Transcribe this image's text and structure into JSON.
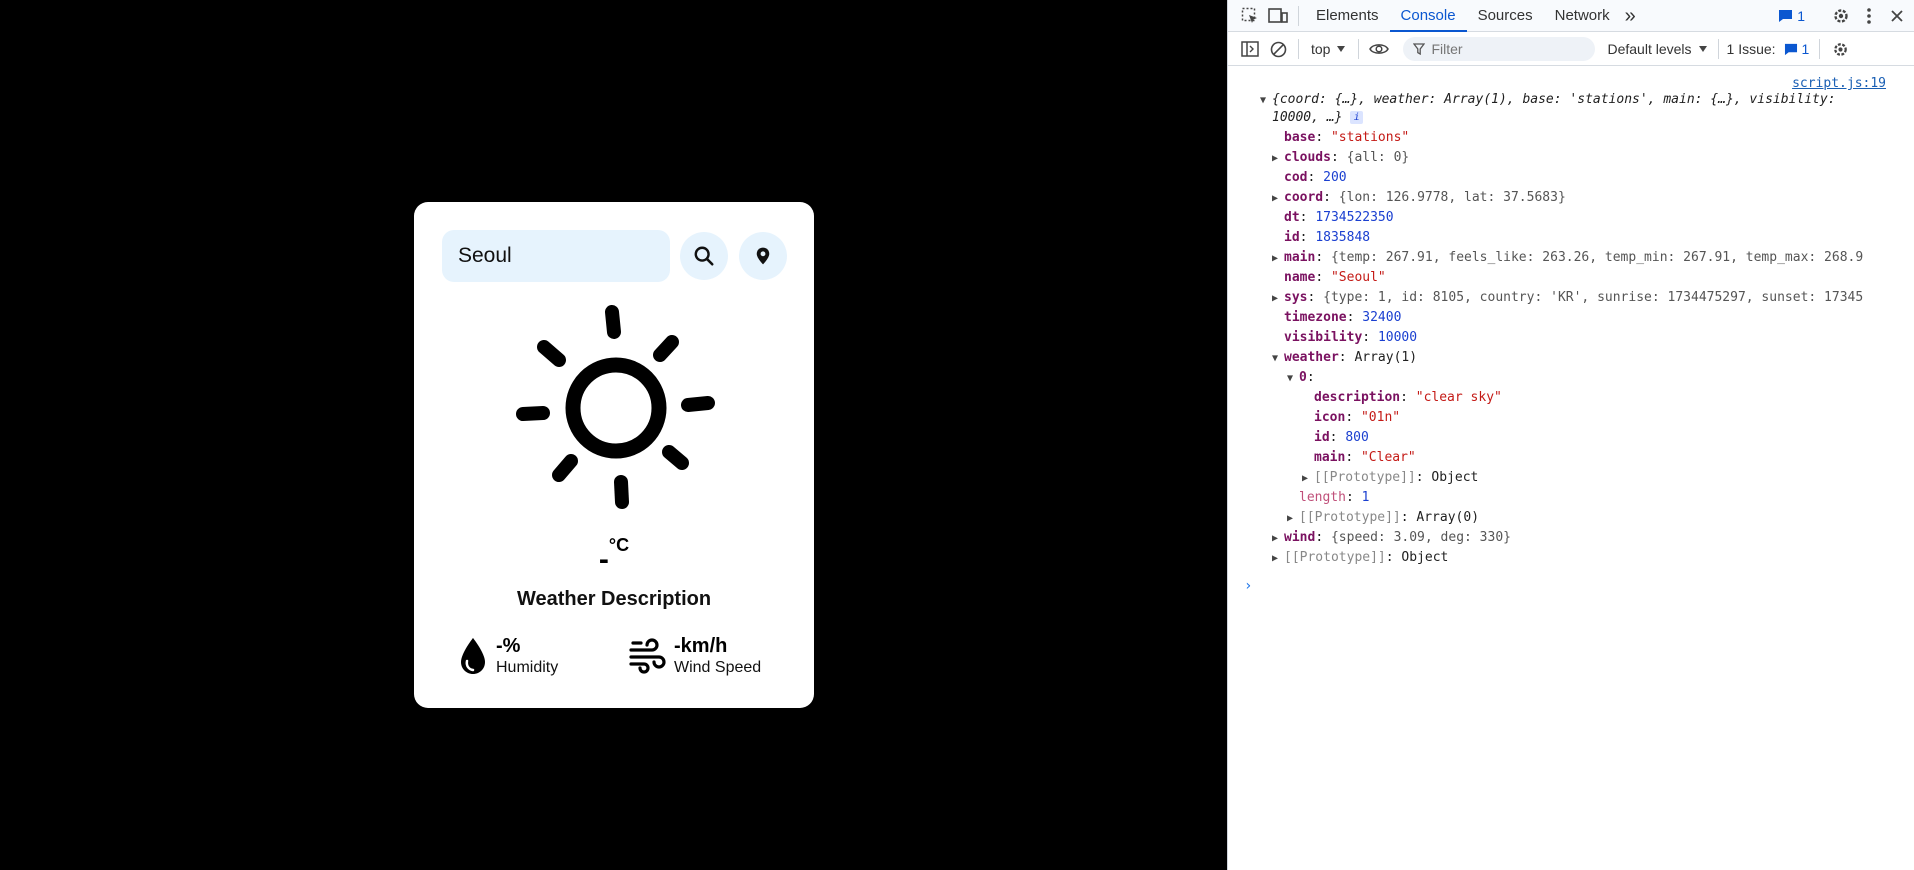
{
  "weather_app": {
    "search_value": "Seoul",
    "temp_value": "-",
    "temp_unit": "°C",
    "description": "Weather Description",
    "humidity_value": "-%",
    "humidity_label": "Humidity",
    "wind_value": "-km/h",
    "wind_label": "Wind Speed"
  },
  "devtools": {
    "tabs": [
      "Elements",
      "Console",
      "Sources",
      "Network"
    ],
    "active_tab": "Console",
    "more_tabs": "»",
    "message_count": "1",
    "toolbar": {
      "context": "top",
      "filter_placeholder": "Filter",
      "levels": "Default levels",
      "issues_label": "1 Issue:",
      "issues_count": "1"
    },
    "source_link": "script.js:19",
    "summary_line1": "{coord: {…}, weather: Array(1), base: 'stations', main: {…}, visibility:",
    "summary_line2": "10000, …}",
    "props": {
      "base_key": "base",
      "base_val": "\"stations\"",
      "clouds_key": "clouds",
      "clouds_val": "{all: 0}",
      "cod_key": "cod",
      "cod_val": "200",
      "coord_key": "coord",
      "coord_val": "{lon: 126.9778, lat: 37.5683}",
      "dt_key": "dt",
      "dt_val": "1734522350",
      "id_key": "id",
      "id_val": "1835848",
      "main_key": "main",
      "main_val": "{temp: 267.91, feels_like: 263.26, temp_min: 267.91, temp_max: 268.9",
      "name_key": "name",
      "name_val": "\"Seoul\"",
      "sys_key": "sys",
      "sys_val": "{type: 1, id: 8105, country: 'KR', sunrise: 1734475297, sunset: 17345",
      "timezone_key": "timezone",
      "timezone_val": "32400",
      "visibility_key": "visibility",
      "visibility_val": "10000",
      "weather_key": "weather",
      "weather_val": "Array(1)",
      "w0_key": "0",
      "w0_desc_key": "description",
      "w0_desc_val": "\"clear sky\"",
      "w0_icon_key": "icon",
      "w0_icon_val": "\"01n\"",
      "w0_id_key": "id",
      "w0_id_val": "800",
      "w0_main_key": "main",
      "w0_main_val": "\"Clear\"",
      "w0_proto_key": "[[Prototype]]",
      "w0_proto_val": "Object",
      "length_key": "length",
      "length_val": "1",
      "arr_proto_key": "[[Prototype]]",
      "arr_proto_val": "Array(0)",
      "wind_key": "wind",
      "wind_val": "{speed: 3.09, deg: 330}",
      "proto_key": "[[Prototype]]",
      "proto_val": "Object"
    },
    "prompt": "›"
  },
  "colors": {
    "card_bg": "#ffffff",
    "input_bg": "#e6f3fd",
    "devtools_accent": "#0b57d0",
    "page_bg": "#000000"
  },
  "icons": [
    "search-icon",
    "location-pin-icon",
    "sun-icon",
    "water-drop-icon",
    "wind-icon"
  ]
}
